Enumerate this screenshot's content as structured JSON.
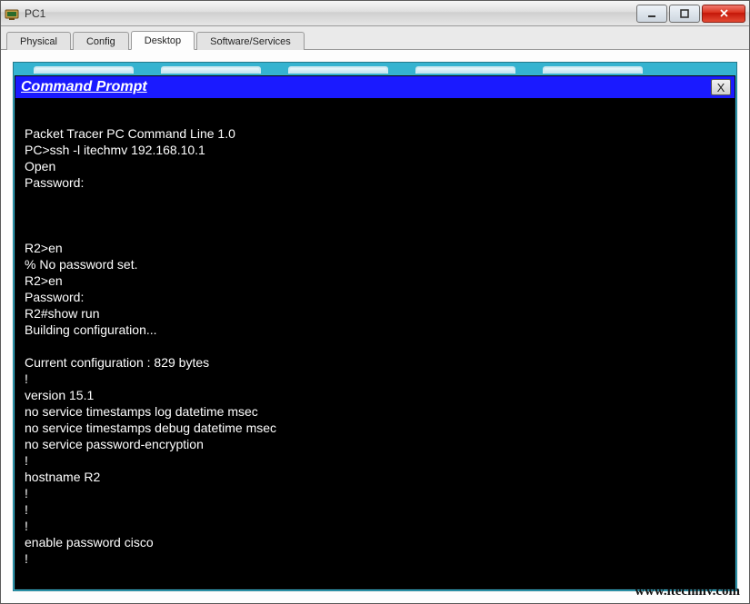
{
  "window": {
    "title": "PC1"
  },
  "tabs": [
    {
      "label": "Physical",
      "active": false
    },
    {
      "label": "Config",
      "active": false
    },
    {
      "label": "Desktop",
      "active": true
    },
    {
      "label": "Software/Services",
      "active": false
    }
  ],
  "command_prompt": {
    "title": "Command Prompt",
    "close_label": "X",
    "lines": [
      "",
      "Packet Tracer PC Command Line 1.0",
      "PC>ssh -l itechmv 192.168.10.1",
      "Open",
      "Password:",
      "",
      "",
      "",
      "R2>en",
      "% No password set.",
      "R2>en",
      "Password:",
      "R2#show run",
      "Building configuration...",
      "",
      "Current configuration : 829 bytes",
      "!",
      "version 15.1",
      "no service timestamps log datetime msec",
      "no service timestamps debug datetime msec",
      "no service password-encryption",
      "!",
      "hostname R2",
      "!",
      "!",
      "!",
      "enable password cisco",
      "!"
    ]
  },
  "watermark": "www.itechmv.com"
}
